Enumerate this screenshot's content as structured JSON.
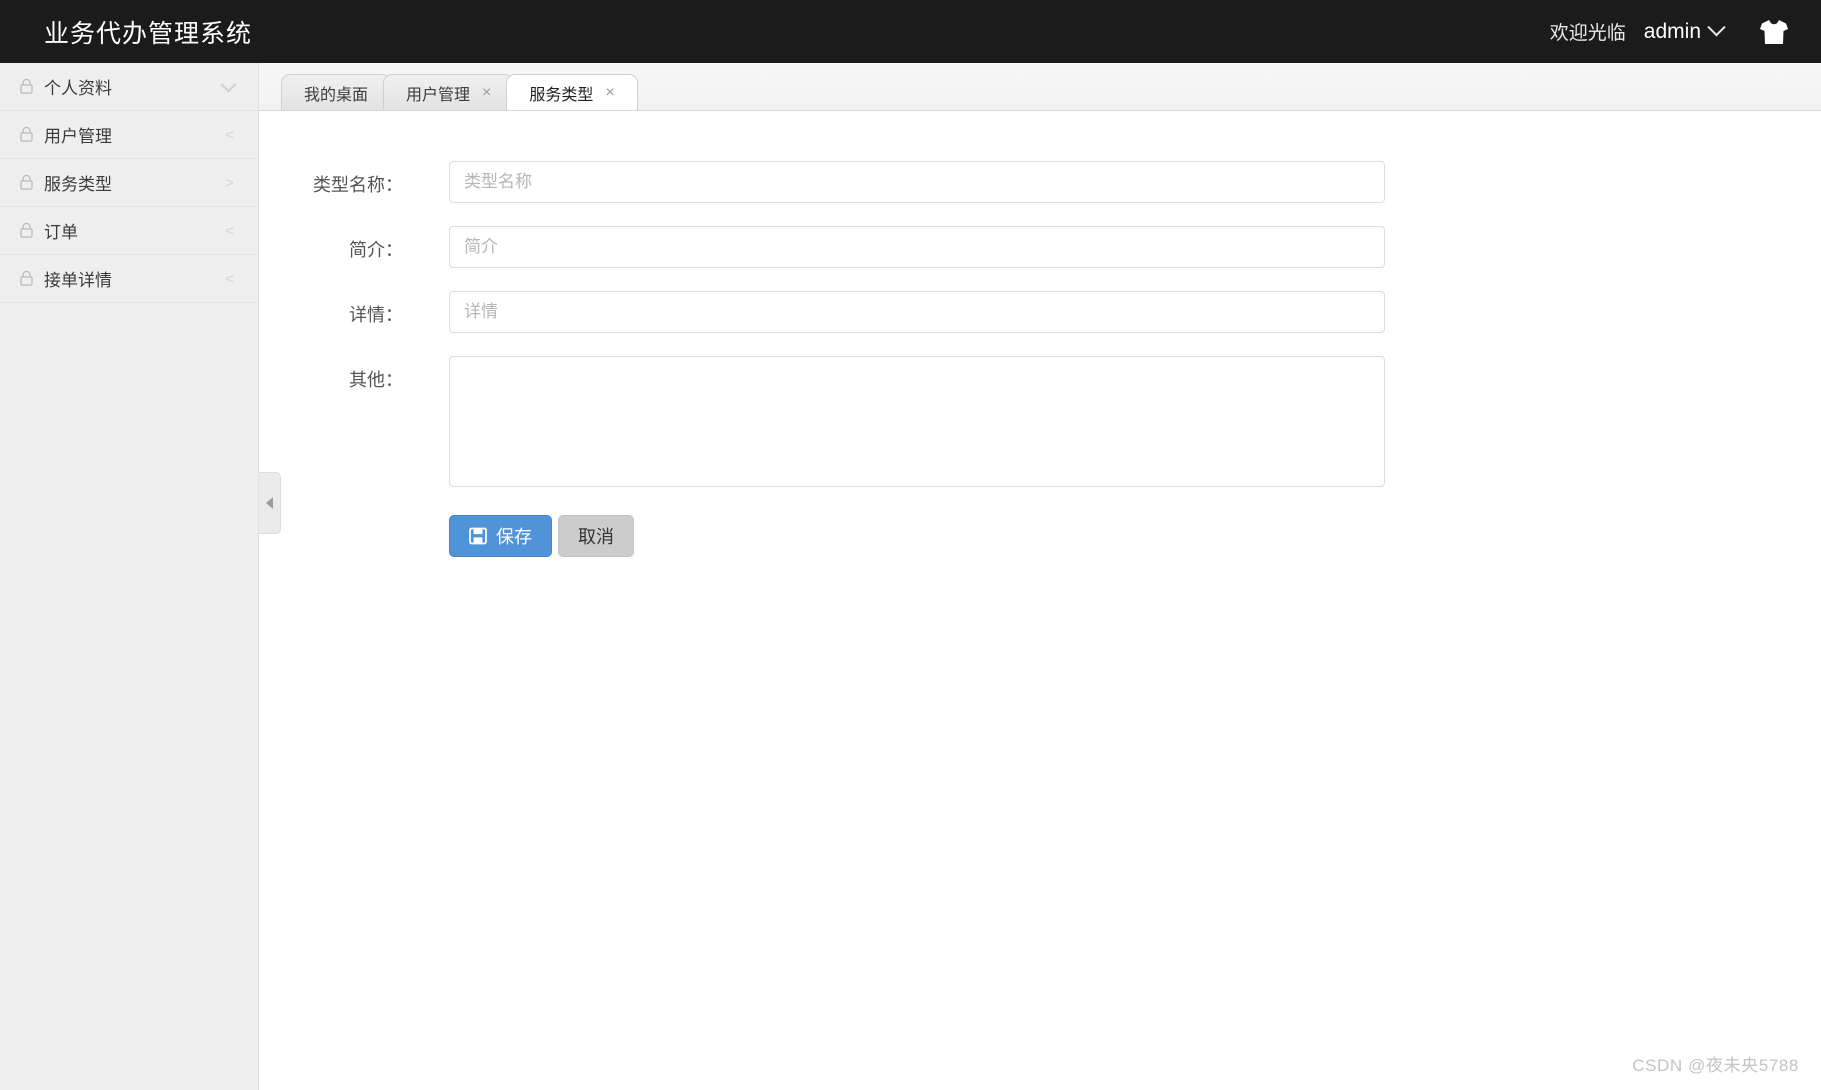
{
  "header": {
    "brand": "业务代办管理系统",
    "welcome": "欢迎光临",
    "username": "admin",
    "caret_icon": "chevron-down-icon",
    "shirt_icon": "t-shirt-icon"
  },
  "sidebar": {
    "items": [
      {
        "label": "个人资料",
        "icon": "lock-icon",
        "arrow": "∨",
        "arrow_type": "chevron-down"
      },
      {
        "label": "用户管理",
        "icon": "lock-icon",
        "arrow": "<",
        "arrow_type": "chevron-left"
      },
      {
        "label": "服务类型",
        "icon": "lock-icon",
        "arrow": ">",
        "arrow_type": "chevron-right"
      },
      {
        "label": "订单",
        "icon": "lock-icon",
        "arrow": "<",
        "arrow_type": "chevron-left"
      },
      {
        "label": "接单详情",
        "icon": "lock-icon",
        "arrow": "<",
        "arrow_type": "chevron-left"
      }
    ]
  },
  "tabs": [
    {
      "label": "我的桌面",
      "closable": false,
      "active": false,
      "close_label": ""
    },
    {
      "label": "用户管理",
      "closable": true,
      "active": false,
      "close_label": "×"
    },
    {
      "label": "服务类型",
      "closable": true,
      "active": true,
      "close_label": "×"
    }
  ],
  "form": {
    "fields": [
      {
        "label": "类型名称：",
        "placeholder": "类型名称",
        "value": "",
        "type": "text"
      },
      {
        "label": "简介：",
        "placeholder": "简介",
        "value": "",
        "type": "text"
      },
      {
        "label": "详情：",
        "placeholder": "详情",
        "value": "",
        "type": "text"
      },
      {
        "label": "其他：",
        "placeholder": "",
        "value": "",
        "type": "textarea"
      }
    ],
    "save_label": "保存",
    "cancel_label": "取消",
    "save_icon": "save-floppy-icon"
  },
  "collapse_handle": {
    "icon": "triangle-left-icon"
  },
  "watermark": "CSDN @夜未央5788",
  "colors": {
    "header_bg": "#1b1b1b",
    "sidebar_bg": "#efefef",
    "primary": "#5093d8",
    "cancel": "#cccccc",
    "content_bg": "#ffffff"
  }
}
